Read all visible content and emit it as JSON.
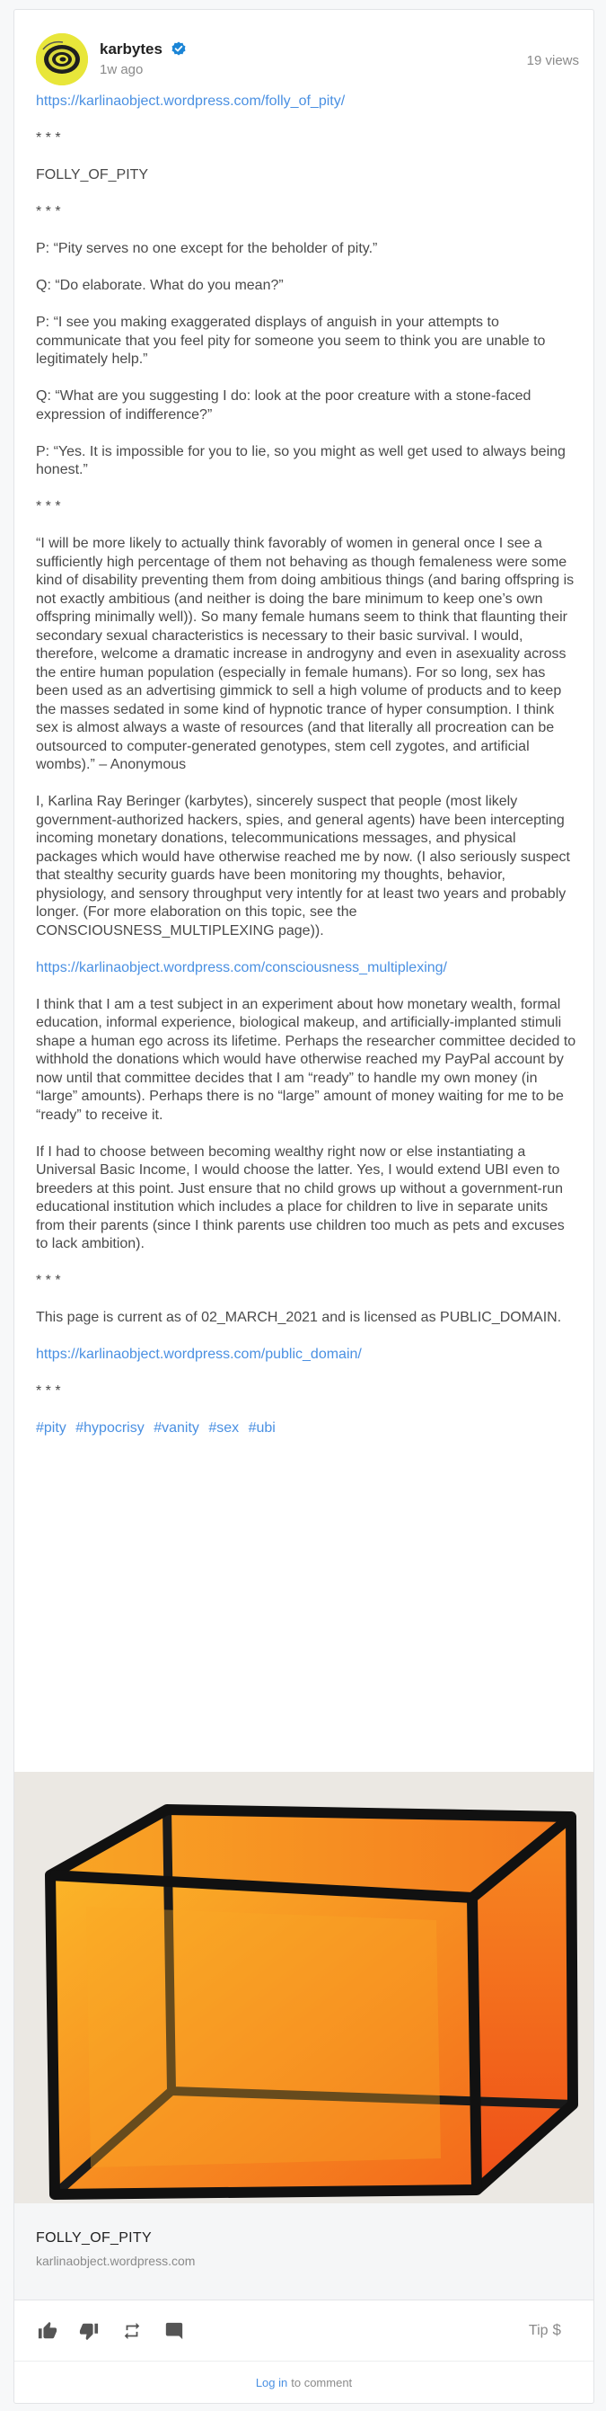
{
  "post": {
    "author": "karbytes",
    "time": "1w ago",
    "views": "19 views"
  },
  "content": {
    "link1": "https://karlinaobject.wordpress.com/folly_of_pity/",
    "sep1": "* * *",
    "title": "FOLLY_OF_PITY",
    "sep2": "* * *",
    "d1": "P: “Pity serves no one except for the beholder of pity.”",
    "d2": "Q: “Do elaborate. What do you mean?”",
    "d3": "P: “I see you making exaggerated displays of anguish in your attempts to communicate that you feel pity for someone you seem to think you are unable to legitimately help.”",
    "d4": "Q: “What are you suggesting I do: look at the poor creature with a stone-faced expression of indifference?”",
    "d5": "P: “Yes. It is impossible for you to lie, so you might as well get used to always being honest.”",
    "sep3": "* * *",
    "quote": "“I will be more likely to actually think favorably of women in general once I see a sufficiently high percentage of them not behaving as though femaleness were some kind of disability preventing them from doing ambitious things (and baring offspring is not exactly ambitious (and neither is doing the bare minimum to keep one’s own offspring minimally well)). So many female humans seem to think that flaunting their secondary sexual characteristics is necessary to their basic survival. I would, therefore, welcome a dramatic increase in androgyny and even in asexuality across the entire human population (especially in female humans). For so long, sex has been used as an advertising gimmick to sell a high volume of products and to keep the masses sedated in some kind of hypnotic trance of hyper consumption. I think sex is almost always a waste of resources (and that literally all procreation can be outsourced to computer-generated genotypes, stem cell zygotes, and artificial wombs).” – Anonymous",
    "para1": "I, Karlina Ray Beringer (karbytes), sincerely suspect that people (most likely government-authorized hackers, spies, and general agents) have been intercepting incoming monetary donations, telecommunications messages, and physical packages which would have otherwise reached me by now. (I also seriously suspect that stealthy security guards have been monitoring my thoughts, behavior, physiology, and sensory throughput very intently for at least two years and probably longer. (For more elaboration on this topic, see the CONSCIOUSNESS_MULTIPLEXING page)).",
    "link2": "https://karlinaobject.wordpress.com/consciousness_multiplexing/",
    "para2": "I think that I am a test subject in an experiment about how monetary wealth, formal education, informal experience, biological makeup, and artificially-implanted stimuli shape a human ego across its lifetime. Perhaps the researcher committee decided to withhold the donations which would have otherwise reached my PayPal account by now until that committee decides that I am “ready” to handle my own money (in “large” amounts). Perhaps there is no “large” amount of money waiting for me to be “ready” to receive it.",
    "para3": "If I had to choose between becoming wealthy right now or else instantiating a Universal Basic Income, I would choose the latter. Yes, I would extend UBI even to breeders at this point. Just ensure that no child grows up without a government-run educational institution which includes a place for children to live in separate units from their parents (since I think parents use children too much as pets and excuses to lack ambition).",
    "sep4": "* * *",
    "license": "This page is current as of 02_MARCH_2021 and is licensed as PUBLIC_DOMAIN.",
    "link3": "https://karlinaobject.wordpress.com/public_domain/",
    "sep5": "* * *",
    "hashtags": [
      "#pity",
      "#hypocrisy",
      "#vanity",
      "#sex",
      "#ubi"
    ]
  },
  "link_preview": {
    "title": "FOLLY_OF_PITY",
    "domain": "karlinaobject.wordpress.com"
  },
  "actions": {
    "tip_label": "Tip",
    "tip_icon": "$",
    "icons": [
      "thumbs-up-icon",
      "thumbs-down-icon",
      "remind-icon",
      "comment-icon"
    ]
  },
  "comments": {
    "login_label": "Log in",
    "suffix": "to comment"
  },
  "colors": {
    "link": "#4a90e2",
    "verified": "#1b85d6",
    "cube_fill": "#f59a1c",
    "cube_edge": "#111111"
  }
}
